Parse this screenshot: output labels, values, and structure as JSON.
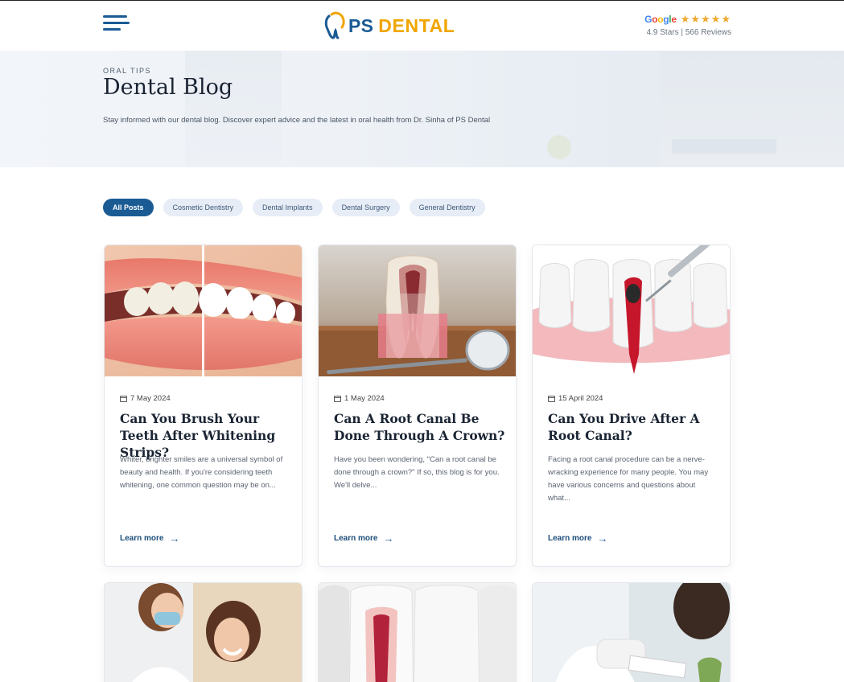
{
  "header": {
    "logo_ps": "PS",
    "logo_dental": "DENTAL",
    "google_label": "Google",
    "stars": "★★★★★",
    "rating_text": "4.9 Stars | 566 Reviews"
  },
  "hero": {
    "eyebrow": "ORAL TIPS",
    "title": "Dental Blog",
    "description": "Stay informed with our dental blog. Discover expert advice and the latest in oral health from Dr. Sinha of PS Dental"
  },
  "filters": [
    {
      "label": "All Posts",
      "active": true
    },
    {
      "label": "Cosmetic Dentistry",
      "active": false
    },
    {
      "label": "Dental Implants",
      "active": false
    },
    {
      "label": "Dental Surgery",
      "active": false
    },
    {
      "label": "General Dentistry",
      "active": false
    }
  ],
  "posts": [
    {
      "date": "7 May 2024",
      "title": "Can You Brush Your Teeth After Whitening Strips?",
      "excerpt": "Whiter, brighter smiles are a universal symbol of beauty and health. If you're considering teeth whitening, one common question may be on...",
      "link": "Learn more"
    },
    {
      "date": "1 May 2024",
      "title": "Can A Root Canal Be Done Through A Crown?",
      "excerpt": "Have you been wondering, \"Can a root canal be done through a crown?\" If so, this blog is for you. We'll delve...",
      "link": "Learn more"
    },
    {
      "date": "15 April 2024",
      "title": "Can You Drive After A Root Canal?",
      "excerpt": "Facing a root canal procedure can be a nerve-wracking experience for many people. You may have various concerns and questions about what...",
      "link": "Learn more"
    }
  ],
  "colors": {
    "primary": "#1b5b94",
    "accent": "#f0a500",
    "star": "#f0a830",
    "chip_bg": "#e7edf6"
  }
}
